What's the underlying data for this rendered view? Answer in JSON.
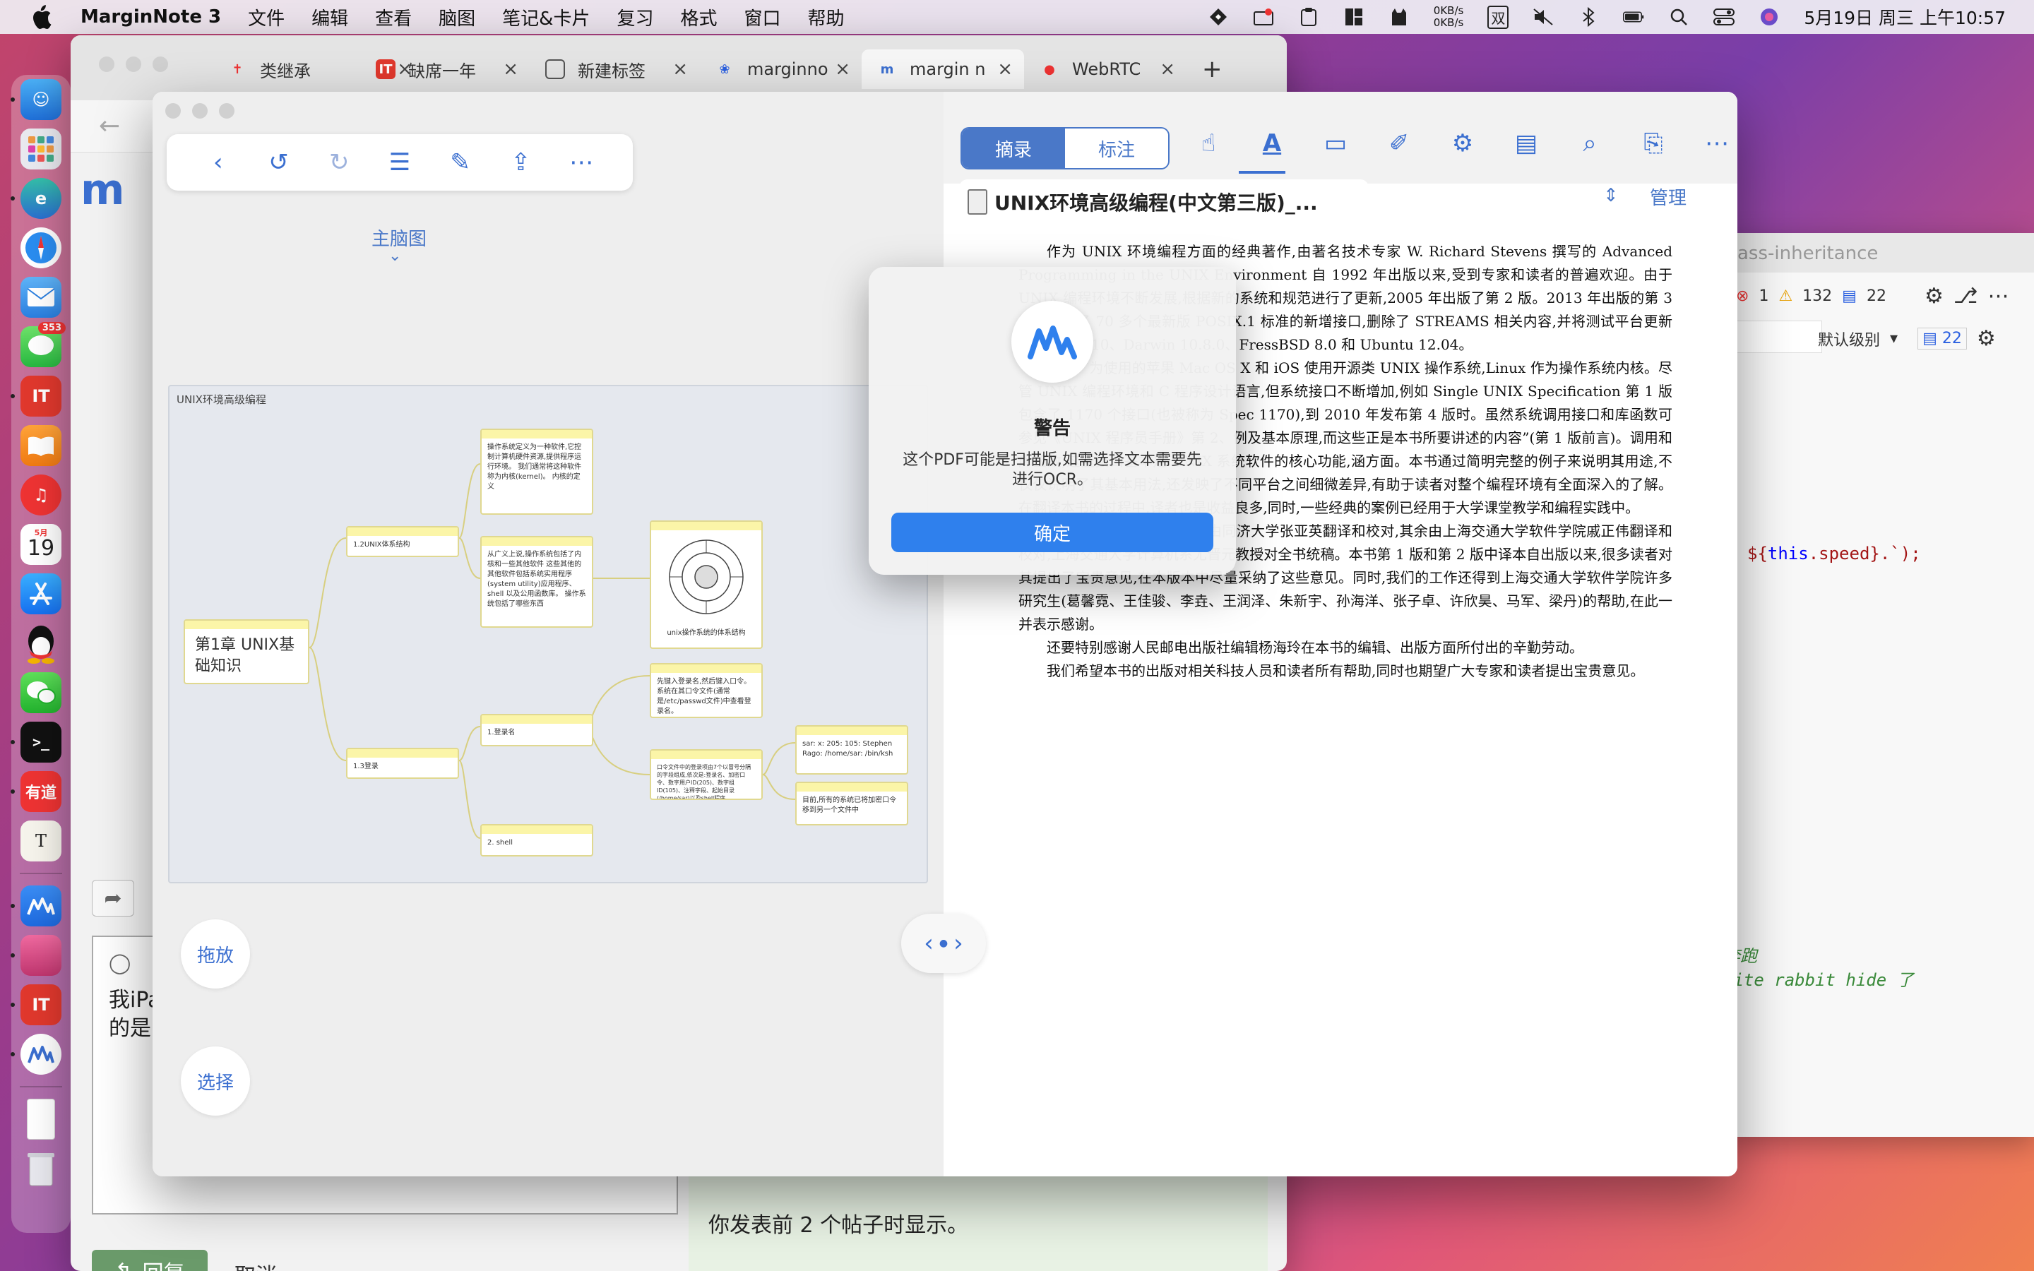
{
  "menubar": {
    "app_name": "MarginNote 3",
    "items": [
      "文件",
      "编辑",
      "查看",
      "脑图",
      "笔记&卡片",
      "复习",
      "格式",
      "窗口",
      "帮助"
    ],
    "net_up": "0KB/s",
    "net_down": "0KB/s",
    "ime": "双",
    "clock": "5月19日 周三 上午10:57"
  },
  "dock": {
    "messages_badge": "353",
    "calendar_month": "5月",
    "calendar_day": "19",
    "youdao": "有道"
  },
  "browser": {
    "tabs": [
      {
        "label": "类继承"
      },
      {
        "label": "缺席一年"
      },
      {
        "label": "新建标签"
      },
      {
        "label": "marginno"
      },
      {
        "label": "margin n"
      },
      {
        "label": "WebRTC"
      }
    ],
    "reply_text_line1": "我iPa",
    "reply_text_line2": "的是:",
    "reply_button": "回复",
    "cancel_button": "取消",
    "hint_text": "你发表前 2 个帖子时显示。"
  },
  "vscode": {
    "title": "ass-inheritance",
    "errors": "1",
    "warnings": "132",
    "comments": "22",
    "level_label": "默认级别",
    "level_count": "22",
    "code1_pre": "${",
    "code1_kw": "this",
    "code1_post": ".speed}.`);",
    "code2": ";",
    "code3": ";",
    "code4": "奔跑",
    "code5": "hite rabbit hide 了"
  },
  "marginnote": {
    "main_map_label": "主脑图",
    "drag_button": "拖放",
    "select_button": "选择",
    "mindmap_title": "UNIX环境高级编程",
    "nodes": {
      "root": "第1章 UNIX基础知识",
      "n12": "1.2UNIX体系结构",
      "n13": "1.3登录",
      "kernel": "操作系统定义为一种软件,它控制计算机硬件资源,提供程序运行环境。 我们通常将这种软件称为内核(kernel)。 内核的定义",
      "broad": "从广义上说,操作系统包括了内核和一些其他软件 这些其他的其他软件包括系统实用程序(system utility)应用程序、shell 以及公用函数库。 操作系统包括了哪些东西",
      "diagram_caption": "unix操作系统的体系结构",
      "login_name": "1.登录名",
      "shell": "2. shell",
      "login_desc": "先键入登录名,然后键入口令。系统在其口令文件(通常是/etc/passwd文件)中查看登录名。",
      "passwd_desc": "口令文件中的登录项由7个以冒号分隔的字段组成,依次是:登录名、加密口令、数字用户ID(205)、数字组ID(105)、注释字段、起始目录(/home/sar)以及shell程序(/bin/ksh)。",
      "passwd_example": "sar: x: 205: 105: Stephen Rago: /home/sar: /bin/ksh",
      "passwd_note": "目前,所有的系统已将加密口令移到另一个文件中"
    },
    "segment": {
      "excerpt": "摘录",
      "annotate": "标注"
    },
    "doc_title": "UNIX环境高级编程(中文第三版)_...",
    "manage": "管理",
    "pdf_paragraphs": [
      "作为 UNIX 环境编程方面的经典著作,由著名技术专家 W. Richard Stevens 撰写的 Advanced Programming in the UNIX Environment 自 1992 年出版以来,受到专家和读者的普遍欢迎。由于 UNIX 编程环境不断发展,根据新的系统和规范进行了更新,2005 年出版了第 2 版。2013 年出版的第 3 版中增加了 70 多个最新版 POSIX.1 标准的新增接口,删除了 STREAMS 相关内容,并将测试平台更新为 Solaris 10、Darwin 10.8.0、FressBSD 8.0 和 Ubuntu 12.04。",
      "例如广为使用的苹果 Mac OS X 和 iOS 使用开源类 UNIX 操作系统,Linux 作为操作系统内核。尽管 UNIX 编程环境和 C 程序设计语言,但系统接口不断增加,例如 Single UNIX Specification 第 1 版包含了 1170 个接口(也被称为 Spec 1170),到 2010 年发布第 4 版时。虽然系统调用接口和库函数可参见《UNIX 程序员手册》第 2、例及基本原理,而这些正是本书所要讲述的内容”(第 1 版前言)。调用和库函数,这些接口基本是 UNIX 系统软件的核心功能,涵方面。本书通过简明完整的例子来说明其用途,不仅仅说明了其基本用法,还发映了不同平台之间细微差异,有助于读者对整个编程环境有全面深入的了解。在翻译本书的过程中,译者也是收益良多,同时,一些经典的案例已经用于大学课堂教学和编程实践中。",
      "本书的第 2 章至第 12 章由同济大学张亚英翻译和校对,其余由上海交通大学软件学院戚正伟翻译和校对,上海交通大学计算机系尤晋元教授对全书统稿。本书第 1 版和第 2 版中译本自出版以来,很多读者对其提出了宝贵意见,在本版本中尽量采纳了这些意见。同时,我们的工作还得到上海交通大学软件学院许多研究生(葛馨霓、王佳骏、李垚、王润泽、朱新宇、孙海洋、张子卓、许欣昊、马军、梁丹)的帮助,在此一并表示感谢。",
      "还要特别感谢人民邮电出版社编辑杨海玲在本书的编辑、出版方面所付出的辛勤劳动。",
      "我们希望本书的出版对相关科技人员和读者所有帮助,同时也期望广大专家和读者提出宝贵意见。"
    ]
  },
  "alert": {
    "title": "警告",
    "message": "这个PDF可能是扫描版,如需选择文本需要先进行OCR。",
    "confirm": "确定"
  },
  "colors": {
    "accent": "#3b6fd0",
    "confirm_button": "#2f80ed",
    "node_header": "#fbf5a8"
  }
}
